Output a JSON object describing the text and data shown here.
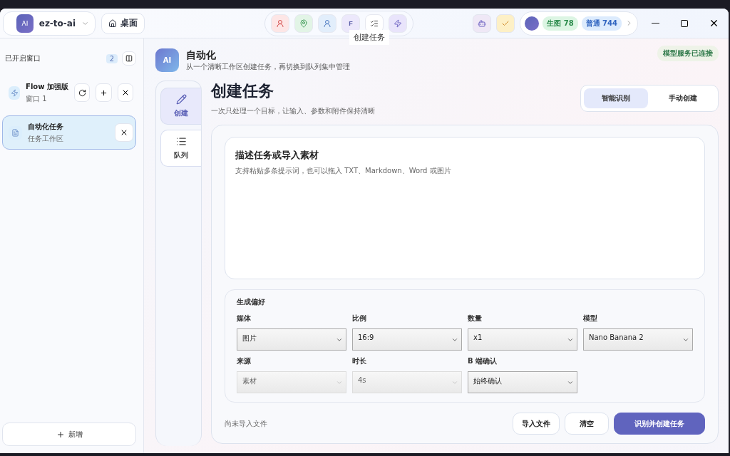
{
  "app_switcher": {
    "avatar": "AI",
    "name": "ez-to-ai"
  },
  "home_button": {
    "label": "桌面"
  },
  "toolbar": [
    {
      "kind": "user",
      "color": "#fde6e6"
    },
    {
      "kind": "pin",
      "color": "#e2f4e6"
    },
    {
      "kind": "user",
      "color": "#e2eefb"
    },
    {
      "kind": "letter",
      "label": "F",
      "color": "#ece8fb"
    },
    {
      "kind": "list",
      "color": "#ffffff"
    },
    {
      "kind": "bolt",
      "color": "#e9e4fb"
    }
  ],
  "tooltip": "创建任务",
  "account": {
    "badges": [
      {
        "label": "生图 78",
        "color": "#dcf5e3"
      },
      {
        "label": "普通 744",
        "color": "#dcebfd"
      }
    ]
  },
  "sidebar": {
    "title": "已开启窗口",
    "count": "2",
    "items": [
      {
        "title": "Flow 加强版",
        "subtitle": "窗口 1",
        "selected": false,
        "actions": [
          {
            "kind": "refresh"
          },
          {
            "kind": "add"
          },
          {
            "kind": "close"
          }
        ]
      },
      {
        "title": "自动化任务",
        "subtitle": "任务工作区",
        "selected": true,
        "actions": [
          {
            "kind": "close"
          }
        ]
      }
    ],
    "add_button": "新增"
  },
  "header": {
    "logo": "AI",
    "title": "自动化",
    "subtitle": "从一个清晰工作区创建任务，再切换到队列集中管理",
    "status": "模型服务已连接"
  },
  "nav": [
    {
      "label": "创建",
      "kind": "pencil",
      "selected": true
    },
    {
      "label": "队列",
      "kind": "list",
      "selected": false
    }
  ],
  "page": {
    "title": "创建任务",
    "subtitle": "一次只处理一个目标，让输入、参数和附件保持清晰"
  },
  "mode_tabs": [
    {
      "label": "智能识别",
      "selected": true
    },
    {
      "label": "手动创建",
      "selected": false
    }
  ],
  "input_area": {
    "title": "描述任务或导入素材",
    "hint": "支持粘贴多条提示词，也可以拖入 TXT、Markdown、Word 或图片"
  },
  "preferences": {
    "title": "生成偏好",
    "fields": [
      {
        "label": "媒体",
        "value": "图片",
        "disabled": false
      },
      {
        "label": "比例",
        "value": "16:9",
        "disabled": false
      },
      {
        "label": "数量",
        "value": "x1",
        "disabled": false
      },
      {
        "label": "模型",
        "value": "Nano Banana 2",
        "disabled": false
      },
      {
        "label": "来源",
        "value": "素材",
        "disabled": true
      },
      {
        "label": "时长",
        "value": "4s",
        "disabled": true
      },
      {
        "label": "B 端确认",
        "value": "始终确认",
        "disabled": false
      }
    ]
  },
  "footer": {
    "file_status": "尚未导入文件",
    "buttons": [
      {
        "label": "导入文件",
        "kind": "secondary"
      },
      {
        "label": "清空",
        "kind": "secondary"
      },
      {
        "label": "识别并创建任务",
        "kind": "primary"
      }
    ]
  }
}
